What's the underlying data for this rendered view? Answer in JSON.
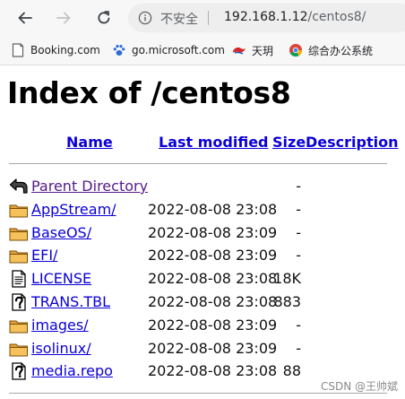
{
  "toolbar": {
    "insecure_label": "不安全",
    "url_host": "192.168.1.12",
    "url_path": "/centos8/"
  },
  "bookmarks": [
    {
      "label": "Booking.com",
      "icon": "booking-icon"
    },
    {
      "label": "go.microsoft.com",
      "icon": "paw-icon"
    },
    {
      "label": "天玥",
      "icon": "tianyue-icon"
    },
    {
      "label": "综合办公系统",
      "icon": "chrome-icon"
    }
  ],
  "page": {
    "title": "Index of /centos8",
    "columns": {
      "name": "Name",
      "last_modified": "Last modified",
      "size": "Size",
      "description": "Description"
    },
    "entries": [
      {
        "name": "Parent Directory",
        "date": "",
        "size": "-",
        "icon": "back-icon",
        "visited": true
      },
      {
        "name": "AppStream/",
        "date": "2022-08-08 23:08",
        "size": "-",
        "icon": "folder-icon"
      },
      {
        "name": "BaseOS/",
        "date": "2022-08-08 23:09",
        "size": "-",
        "icon": "folder-icon"
      },
      {
        "name": "EFI/",
        "date": "2022-08-08 23:09",
        "size": "-",
        "icon": "folder-icon"
      },
      {
        "name": "LICENSE",
        "date": "2022-08-08 23:08",
        "size": "18K",
        "icon": "text-file-icon"
      },
      {
        "name": "TRANS.TBL",
        "date": "2022-08-08 23:08",
        "size": "883",
        "icon": "unknown-file-icon"
      },
      {
        "name": "images/",
        "date": "2022-08-08 23:09",
        "size": "-",
        "icon": "folder-icon"
      },
      {
        "name": "isolinux/",
        "date": "2022-08-08 23:09",
        "size": "-",
        "icon": "folder-icon"
      },
      {
        "name": "media.repo",
        "date": "2022-08-08 23:08",
        "size": "88",
        "icon": "unknown-file-icon"
      }
    ]
  },
  "watermark": "CSDN @王帅斌"
}
